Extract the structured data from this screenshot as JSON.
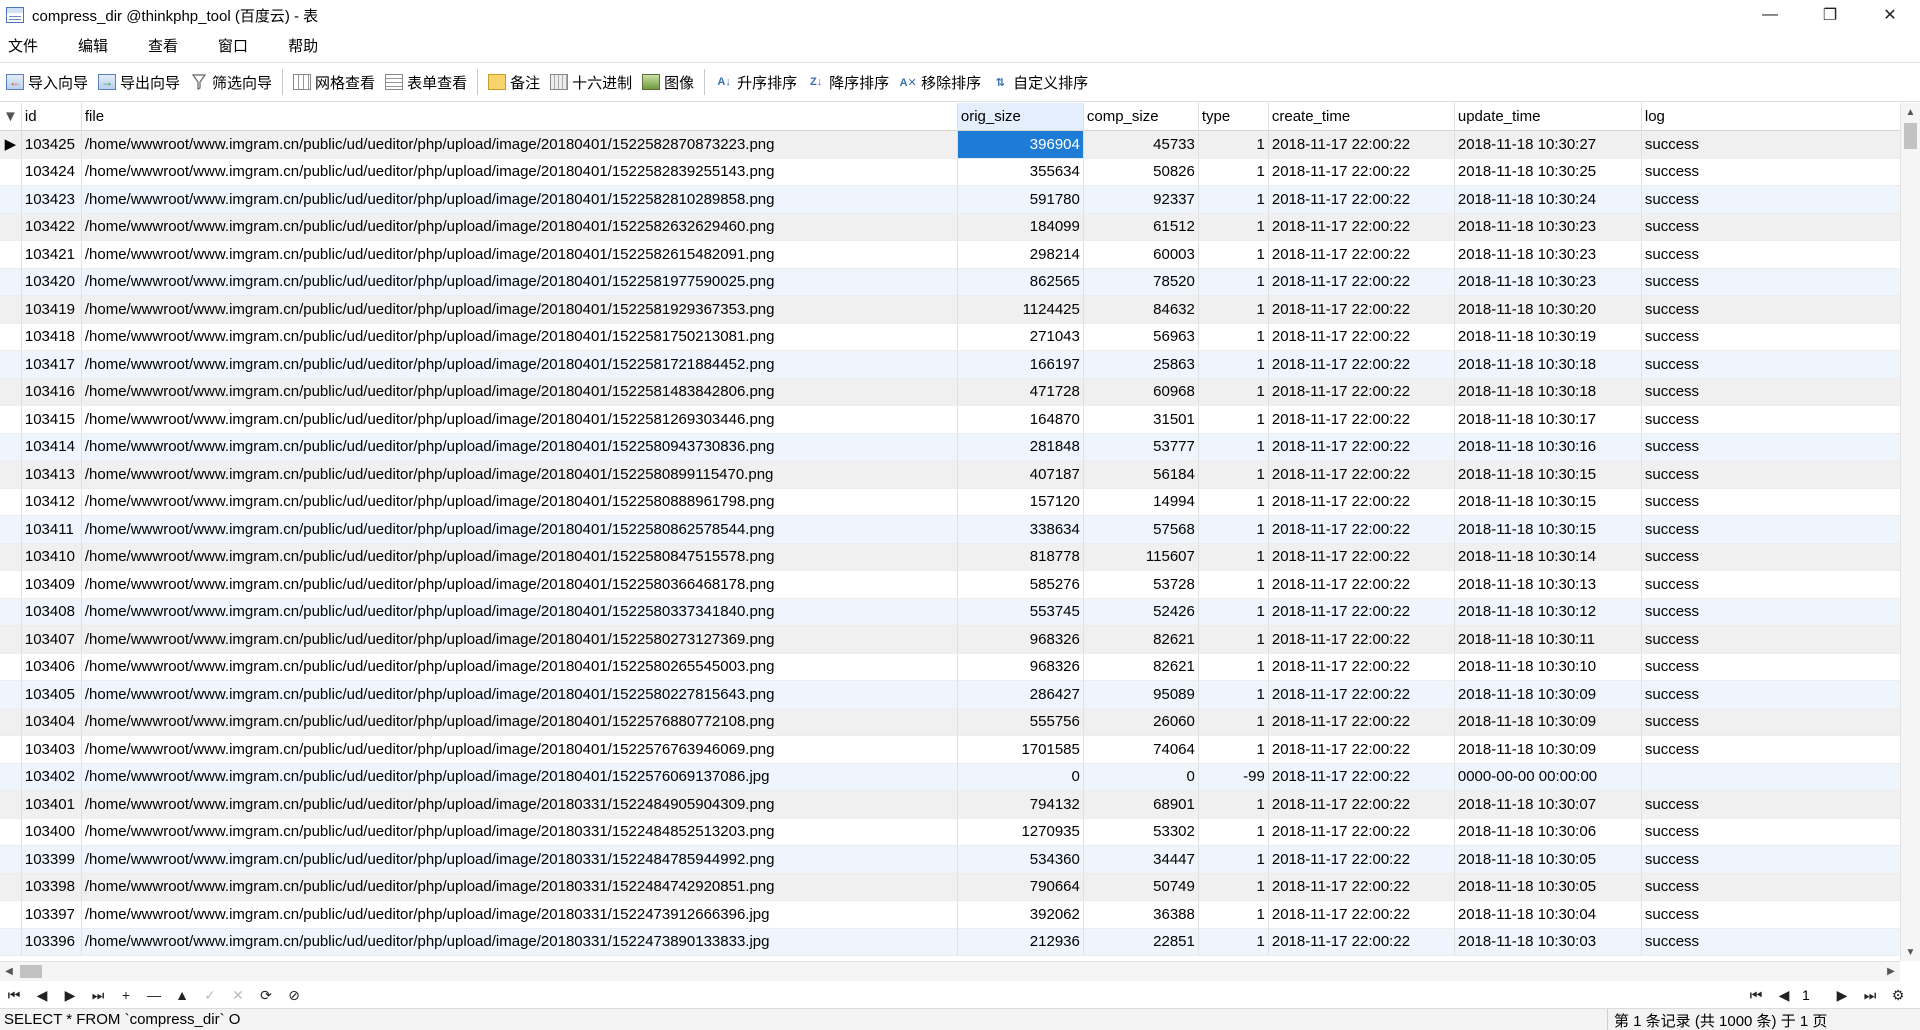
{
  "window": {
    "title": "compress_dir @thinkphp_tool (百度云) - 表",
    "minimize_glyph": "—",
    "maximize_glyph": "❐",
    "close_glyph": "✕"
  },
  "menu": [
    "文件",
    "编辑",
    "查看",
    "窗口",
    "帮助"
  ],
  "toolbar": {
    "import": "导入向导",
    "export": "导出向导",
    "filter": "筛选向导",
    "grid_view": "网格查看",
    "form_view": "表单查看",
    "note": "备注",
    "hex": "十六进制",
    "image": "图像",
    "sort_asc": "升序排序",
    "sort_desc": "降序排序",
    "remove_sort": "移除排序",
    "custom_sort": "自定义排序"
  },
  "columns": [
    "id",
    "file",
    "orig_size",
    "comp_size",
    "type",
    "create_time",
    "update_time",
    "log"
  ],
  "sorted_column": "orig_size",
  "rows": [
    [
      "103425",
      "/home/wwwroot/www.imgram.cn/public/ud/ueditor/php/upload/image/20180401/1522582870873223.png",
      "396904",
      "45733",
      "1",
      "2018-11-17 22:00:22",
      "2018-11-18 10:30:27",
      "success"
    ],
    [
      "103424",
      "/home/wwwroot/www.imgram.cn/public/ud/ueditor/php/upload/image/20180401/1522582839255143.png",
      "355634",
      "50826",
      "1",
      "2018-11-17 22:00:22",
      "2018-11-18 10:30:25",
      "success"
    ],
    [
      "103423",
      "/home/wwwroot/www.imgram.cn/public/ud/ueditor/php/upload/image/20180401/1522582810289858.png",
      "591780",
      "92337",
      "1",
      "2018-11-17 22:00:22",
      "2018-11-18 10:30:24",
      "success"
    ],
    [
      "103422",
      "/home/wwwroot/www.imgram.cn/public/ud/ueditor/php/upload/image/20180401/1522582632629460.png",
      "184099",
      "61512",
      "1",
      "2018-11-17 22:00:22",
      "2018-11-18 10:30:23",
      "success"
    ],
    [
      "103421",
      "/home/wwwroot/www.imgram.cn/public/ud/ueditor/php/upload/image/20180401/1522582615482091.png",
      "298214",
      "60003",
      "1",
      "2018-11-17 22:00:22",
      "2018-11-18 10:30:23",
      "success"
    ],
    [
      "103420",
      "/home/wwwroot/www.imgram.cn/public/ud/ueditor/php/upload/image/20180401/1522581977590025.png",
      "862565",
      "78520",
      "1",
      "2018-11-17 22:00:22",
      "2018-11-18 10:30:23",
      "success"
    ],
    [
      "103419",
      "/home/wwwroot/www.imgram.cn/public/ud/ueditor/php/upload/image/20180401/1522581929367353.png",
      "1124425",
      "84632",
      "1",
      "2018-11-17 22:00:22",
      "2018-11-18 10:30:20",
      "success"
    ],
    [
      "103418",
      "/home/wwwroot/www.imgram.cn/public/ud/ueditor/php/upload/image/20180401/1522581750213081.png",
      "271043",
      "56963",
      "1",
      "2018-11-17 22:00:22",
      "2018-11-18 10:30:19",
      "success"
    ],
    [
      "103417",
      "/home/wwwroot/www.imgram.cn/public/ud/ueditor/php/upload/image/20180401/1522581721884452.png",
      "166197",
      "25863",
      "1",
      "2018-11-17 22:00:22",
      "2018-11-18 10:30:18",
      "success"
    ],
    [
      "103416",
      "/home/wwwroot/www.imgram.cn/public/ud/ueditor/php/upload/image/20180401/1522581483842806.png",
      "471728",
      "60968",
      "1",
      "2018-11-17 22:00:22",
      "2018-11-18 10:30:18",
      "success"
    ],
    [
      "103415",
      "/home/wwwroot/www.imgram.cn/public/ud/ueditor/php/upload/image/20180401/1522581269303446.png",
      "164870",
      "31501",
      "1",
      "2018-11-17 22:00:22",
      "2018-11-18 10:30:17",
      "success"
    ],
    [
      "103414",
      "/home/wwwroot/www.imgram.cn/public/ud/ueditor/php/upload/image/20180401/1522580943730836.png",
      "281848",
      "53777",
      "1",
      "2018-11-17 22:00:22",
      "2018-11-18 10:30:16",
      "success"
    ],
    [
      "103413",
      "/home/wwwroot/www.imgram.cn/public/ud/ueditor/php/upload/image/20180401/1522580899115470.png",
      "407187",
      "56184",
      "1",
      "2018-11-17 22:00:22",
      "2018-11-18 10:30:15",
      "success"
    ],
    [
      "103412",
      "/home/wwwroot/www.imgram.cn/public/ud/ueditor/php/upload/image/20180401/1522580888961798.png",
      "157120",
      "14994",
      "1",
      "2018-11-17 22:00:22",
      "2018-11-18 10:30:15",
      "success"
    ],
    [
      "103411",
      "/home/wwwroot/www.imgram.cn/public/ud/ueditor/php/upload/image/20180401/1522580862578544.png",
      "338634",
      "57568",
      "1",
      "2018-11-17 22:00:22",
      "2018-11-18 10:30:15",
      "success"
    ],
    [
      "103410",
      "/home/wwwroot/www.imgram.cn/public/ud/ueditor/php/upload/image/20180401/1522580847515578.png",
      "818778",
      "115607",
      "1",
      "2018-11-17 22:00:22",
      "2018-11-18 10:30:14",
      "success"
    ],
    [
      "103409",
      "/home/wwwroot/www.imgram.cn/public/ud/ueditor/php/upload/image/20180401/1522580366468178.png",
      "585276",
      "53728",
      "1",
      "2018-11-17 22:00:22",
      "2018-11-18 10:30:13",
      "success"
    ],
    [
      "103408",
      "/home/wwwroot/www.imgram.cn/public/ud/ueditor/php/upload/image/20180401/1522580337341840.png",
      "553745",
      "52426",
      "1",
      "2018-11-17 22:00:22",
      "2018-11-18 10:30:12",
      "success"
    ],
    [
      "103407",
      "/home/wwwroot/www.imgram.cn/public/ud/ueditor/php/upload/image/20180401/1522580273127369.png",
      "968326",
      "82621",
      "1",
      "2018-11-17 22:00:22",
      "2018-11-18 10:30:11",
      "success"
    ],
    [
      "103406",
      "/home/wwwroot/www.imgram.cn/public/ud/ueditor/php/upload/image/20180401/1522580265545003.png",
      "968326",
      "82621",
      "1",
      "2018-11-17 22:00:22",
      "2018-11-18 10:30:10",
      "success"
    ],
    [
      "103405",
      "/home/wwwroot/www.imgram.cn/public/ud/ueditor/php/upload/image/20180401/1522580227815643.png",
      "286427",
      "95089",
      "1",
      "2018-11-17 22:00:22",
      "2018-11-18 10:30:09",
      "success"
    ],
    [
      "103404",
      "/home/wwwroot/www.imgram.cn/public/ud/ueditor/php/upload/image/20180401/1522576880772108.png",
      "555756",
      "26060",
      "1",
      "2018-11-17 22:00:22",
      "2018-11-18 10:30:09",
      "success"
    ],
    [
      "103403",
      "/home/wwwroot/www.imgram.cn/public/ud/ueditor/php/upload/image/20180401/1522576763946069.png",
      "1701585",
      "74064",
      "1",
      "2018-11-17 22:00:22",
      "2018-11-18 10:30:09",
      "success"
    ],
    [
      "103402",
      "/home/wwwroot/www.imgram.cn/public/ud/ueditor/php/upload/image/20180401/1522576069137086.jpg",
      "0",
      "0",
      "-99",
      "2018-11-17 22:00:22",
      "0000-00-00 00:00:00",
      ""
    ],
    [
      "103401",
      "/home/wwwroot/www.imgram.cn/public/ud/ueditor/php/upload/image/20180331/1522484905904309.png",
      "794132",
      "68901",
      "1",
      "2018-11-17 22:00:22",
      "2018-11-18 10:30:07",
      "success"
    ],
    [
      "103400",
      "/home/wwwroot/www.imgram.cn/public/ud/ueditor/php/upload/image/20180331/1522484852513203.png",
      "1270935",
      "53302",
      "1",
      "2018-11-17 22:00:22",
      "2018-11-18 10:30:06",
      "success"
    ],
    [
      "103399",
      "/home/wwwroot/www.imgram.cn/public/ud/ueditor/php/upload/image/20180331/1522484785944992.png",
      "534360",
      "34447",
      "1",
      "2018-11-17 22:00:22",
      "2018-11-18 10:30:05",
      "success"
    ],
    [
      "103398",
      "/home/wwwroot/www.imgram.cn/public/ud/ueditor/php/upload/image/20180331/1522484742920851.png",
      "790664",
      "50749",
      "1",
      "2018-11-17 22:00:22",
      "2018-11-18 10:30:05",
      "success"
    ],
    [
      "103397",
      "/home/wwwroot/www.imgram.cn/public/ud/ueditor/php/upload/image/20180331/1522473912666396.jpg",
      "392062",
      "36388",
      "1",
      "2018-11-17 22:00:22",
      "2018-11-18 10:30:04",
      "success"
    ],
    [
      "103396",
      "/home/wwwroot/www.imgram.cn/public/ud/ueditor/php/upload/image/20180331/1522473890133833.jpg",
      "212936",
      "22851",
      "1",
      "2018-11-17 22:00:22",
      "2018-11-18 10:30:03",
      "success"
    ]
  ],
  "selected": {
    "row": 0,
    "column": "orig_size"
  },
  "nav": {
    "first": "⏮",
    "prev": "◀",
    "next": "▶",
    "last": "⏭",
    "add": "+",
    "delete": "—",
    "apply": "▲",
    "commit": "✓",
    "cancel": "✕",
    "refresh": "⟳",
    "stop": "⊘",
    "page_first": "⏮",
    "page_prev": "◀",
    "page_value": "1",
    "page_next": "▶",
    "page_last": "⏭",
    "settings": "⚙"
  },
  "status": {
    "sql": "SELECT * FROM `compress_dir` O",
    "records": "第 1 条记录 (共 1000 条) 于 1 页"
  }
}
